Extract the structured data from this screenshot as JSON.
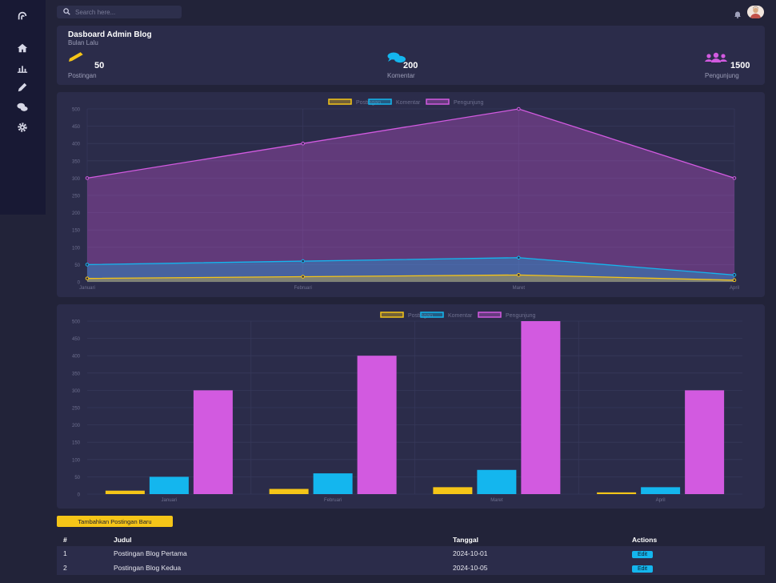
{
  "topbar": {
    "search_placeholder": "Search here..."
  },
  "sidebar": {
    "items": [
      "logo-icon",
      "home-icon",
      "chart-icon",
      "edit-icon",
      "comments-icon",
      "settings-icon"
    ]
  },
  "dashboard": {
    "title": "Dasboard Admin Blog",
    "subtitle": "Bulan Lalu",
    "stats": [
      {
        "value": "50",
        "label": "Postingan",
        "icon": "pencil-icon",
        "color": "#f5c518"
      },
      {
        "value": "200",
        "label": "Komentar",
        "icon": "comments-icon",
        "color": "#14b6ee"
      },
      {
        "value": "1500",
        "label": "Pengunjung",
        "icon": "users-icon",
        "color": "#d25ae0"
      }
    ]
  },
  "chart_data": [
    {
      "type": "area",
      "categories": [
        "Januari",
        "Februari",
        "Maret",
        "April"
      ],
      "series": [
        {
          "name": "Postingan",
          "values": [
            10,
            15,
            20,
            5
          ],
          "color": "#f5c518"
        },
        {
          "name": "Komentar",
          "values": [
            50,
            60,
            70,
            20
          ],
          "color": "#14b6ee"
        },
        {
          "name": "Pengunjung",
          "values": [
            300,
            400,
            500,
            300
          ],
          "color": "#d25ae0"
        }
      ],
      "yticks": [
        0,
        50,
        100,
        150,
        200,
        250,
        300,
        350,
        400,
        450,
        500
      ],
      "ylim": [
        0,
        500
      ],
      "legend": "top",
      "grid": true
    },
    {
      "type": "bar",
      "categories": [
        "Januari",
        "Februari",
        "Maret",
        "April"
      ],
      "series": [
        {
          "name": "Postingan",
          "values": [
            10,
            15,
            20,
            5
          ],
          "color": "#f5c518"
        },
        {
          "name": "Komentar",
          "values": [
            50,
            60,
            70,
            20
          ],
          "color": "#14b6ee"
        },
        {
          "name": "Pengunjung",
          "values": [
            300,
            400,
            500,
            300
          ],
          "color": "#d25ae0"
        }
      ],
      "yticks": [
        0,
        50,
        100,
        150,
        200,
        250,
        300,
        350,
        400,
        450,
        500
      ],
      "ylim": [
        0,
        500
      ],
      "legend": "top",
      "grid": true
    }
  ],
  "actions": {
    "add_post_label": "Tambahkan Postingan Baru"
  },
  "table": {
    "headers": [
      "#",
      "Judul",
      "Tanggal",
      "Actions"
    ],
    "rows": [
      {
        "no": "1",
        "title": "Postingan Blog Pertama",
        "date": "2024-10-01",
        "action": "Edit"
      },
      {
        "no": "2",
        "title": "Postingan Blog Kedua",
        "date": "2024-10-05",
        "action": "Edit"
      }
    ]
  }
}
